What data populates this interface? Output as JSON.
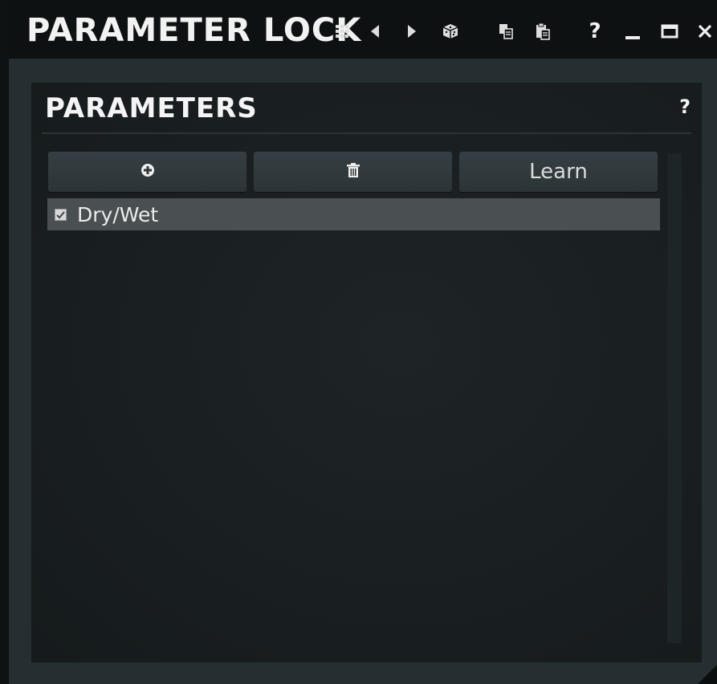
{
  "window": {
    "title": "PARAMETER LOCK",
    "toolbar_icons": [
      "grid-menu-icon",
      "previous-arrow-icon",
      "next-arrow-icon",
      "randomize-dice-icon",
      "copy-icon",
      "paste-icon",
      "help-icon",
      "minimize-icon",
      "maximize-icon",
      "close-icon"
    ],
    "help_label": "?"
  },
  "panel": {
    "title": "PARAMETERS",
    "help_label": "?",
    "buttons": {
      "add_icon": "plus-circle-icon",
      "delete_icon": "trash-icon",
      "learn_label": "Learn"
    },
    "parameters": [
      {
        "label": "Dry/Wet",
        "checked": true
      }
    ]
  },
  "colors": {
    "background": "#0f1213",
    "window": "#252e31",
    "panel": "#1b2123",
    "button": "#313a3e",
    "selected_row": "#4a4f51",
    "text": "#e6e6e6"
  }
}
